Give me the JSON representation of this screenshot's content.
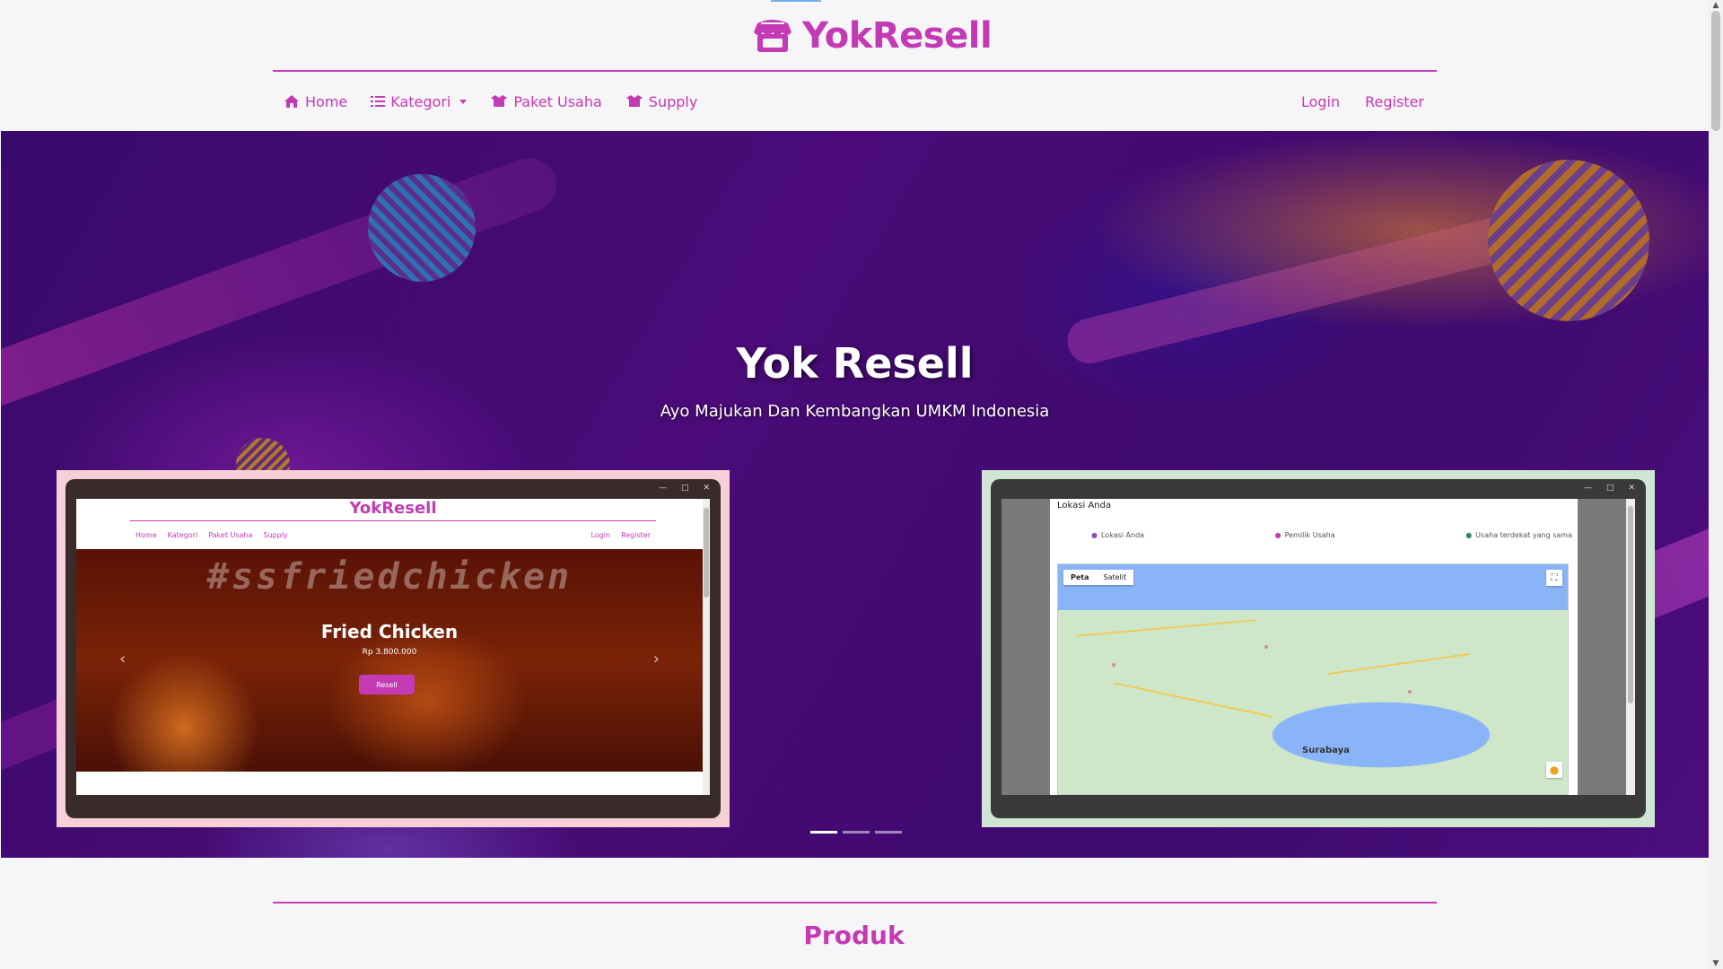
{
  "brand": {
    "name": "YokResell",
    "color": "#c43ab4"
  },
  "nav": {
    "left": [
      {
        "label": "Home",
        "icon": "home-icon"
      },
      {
        "label": "Kategori",
        "icon": "list-icon",
        "dropdown": true
      },
      {
        "label": "Paket Usaha",
        "icon": "boxes-icon"
      },
      {
        "label": "Supply",
        "icon": "boxes-icon"
      }
    ],
    "right": [
      {
        "label": "Login"
      },
      {
        "label": "Register"
      }
    ]
  },
  "hero": {
    "title": "Yok Resell",
    "subtitle": "Ayo Majukan Dan Kembangkan UMKM Indonesia",
    "carousel_active_index": 0,
    "carousel_count": 3
  },
  "preview_left": {
    "brand": "YokResell",
    "nav_left": [
      "Home",
      "Kategori",
      "Paket Usaha",
      "Supply"
    ],
    "nav_right": [
      "Login",
      "Register"
    ],
    "hashtag": "#ssfriedchicken",
    "product": "Fried Chicken",
    "price": "Rp 3.800.000",
    "button": "Resell"
  },
  "preview_right": {
    "title": "Lokasi Anda",
    "legend": [
      "Lokasi Anda",
      "Pemilik Usaha",
      "Usaha terdekat yang sama"
    ],
    "map_tabs": [
      "Peta",
      "Satelit"
    ],
    "city": "Surabaya"
  },
  "section": {
    "title": "Produk"
  }
}
